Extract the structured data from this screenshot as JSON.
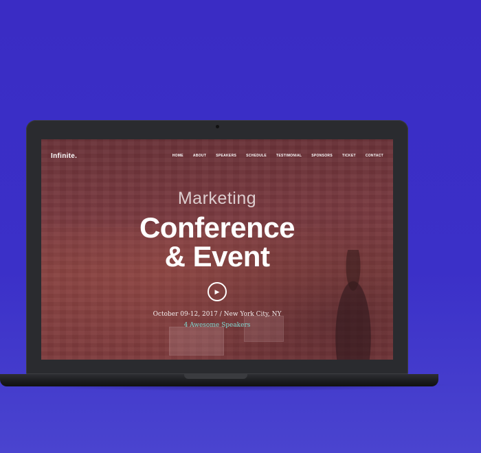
{
  "nav": {
    "logo": "Infinite.",
    "items": [
      "HOME",
      "ABOUT",
      "SPEAKERS",
      "SCHEDULE",
      "TESTIMONIAL",
      "SPONSORS",
      "TICKET",
      "CONTACT"
    ]
  },
  "hero": {
    "subtitle": "Marketing",
    "title_line1": "Conference",
    "title_line2": "& Event",
    "play_icon": "play-icon",
    "date": "October 09-12, 2017 / New York City, NY",
    "speakers": "4 Awesome Speakers"
  },
  "colors": {
    "background": "#3a2cc4",
    "overlay": "#7a3a40",
    "accent": "#7fd8d0"
  }
}
